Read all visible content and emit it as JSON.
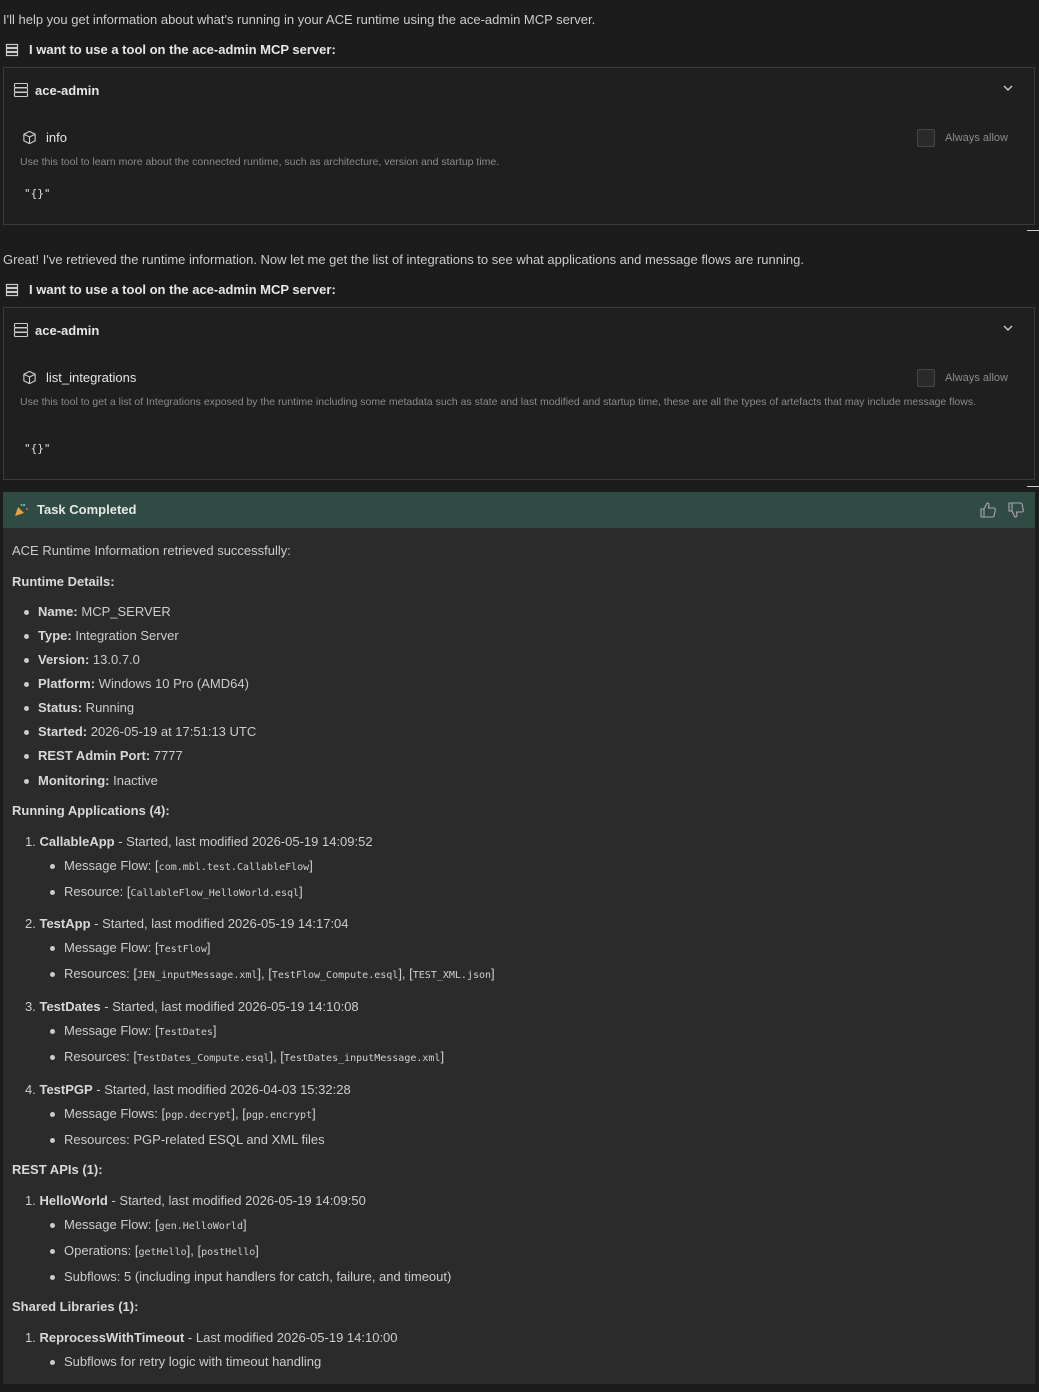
{
  "intro1": "I'll help you get information about what's running in your ACE runtime using the ace-admin MCP server.",
  "tool_request_label": "I want to use a tool on the ace-admin MCP server:",
  "card1": {
    "server": "ace-admin",
    "tool": "info",
    "description": "Use this tool to learn more about the connected runtime, such as architecture, version and startup time.",
    "args": "\"{}\"",
    "always_allow": "Always allow"
  },
  "intro2": "Great! I've retrieved the runtime information. Now let me get the list of integrations to see what applications and message flows are running.",
  "card2": {
    "server": "ace-admin",
    "tool": "list_integrations",
    "description": "Use this tool to get a list of Integrations exposed by the runtime including some metadata such as state and last modified and startup time, these are all the types of artefacts that may include message flows.",
    "args": "\"{}\"",
    "always_allow": "Always allow"
  },
  "task": {
    "title": "Task Completed",
    "summary": "ACE Runtime Information retrieved successfully:",
    "runtime_heading": "Runtime Details:",
    "runtime": [
      {
        "k": "Name:",
        "v": " MCP_SERVER"
      },
      {
        "k": "Type:",
        "v": " Integration Server"
      },
      {
        "k": "Version:",
        "v": " 13.0.7.0"
      },
      {
        "k": "Platform:",
        "v": " Windows 10 Pro (AMD64)"
      },
      {
        "k": "Status:",
        "v": " Running"
      },
      {
        "k": "Started:",
        "v": " 2026-05-19 at 17:51:13 UTC"
      },
      {
        "k": "REST Admin Port:",
        "v": " 7777"
      },
      {
        "k": "Monitoring:",
        "v": " Inactive"
      }
    ],
    "apps_heading": "Running Applications (4):",
    "apps": [
      {
        "num": "1.",
        "name": "CallableApp",
        "meta": " - Started, last modified 2026-05-19 14:09:52",
        "l1": "Message Flow: ",
        "c1": [
          "com.mbl.test.CallableFlow"
        ],
        "l2": "Resource: ",
        "c2": [
          "CallableFlow_HelloWorld.esql"
        ]
      },
      {
        "num": "2.",
        "name": "TestApp",
        "meta": " - Started, last modified 2026-05-19 14:17:04",
        "l1": "Message Flow: ",
        "c1": [
          "TestFlow"
        ],
        "l2": "Resources: ",
        "c2": [
          "JEN_inputMessage.xml",
          "TestFlow_Compute.esql",
          "TEST_XML.json"
        ]
      },
      {
        "num": "3.",
        "name": "TestDates",
        "meta": " - Started, last modified 2026-05-19 14:10:08",
        "l1": "Message Flow: ",
        "c1": [
          "TestDates"
        ],
        "l2": "Resources: ",
        "c2": [
          "TestDates_Compute.esql",
          "TestDates_inputMessage.xml"
        ]
      },
      {
        "num": "4.",
        "name": "TestPGP",
        "meta": " - Started, last modified 2026-04-03 15:32:28",
        "l1": "Message Flows: ",
        "c1": [
          "pgp.decrypt",
          "pgp.encrypt"
        ],
        "l2": "Resources: PGP-related ESQL and XML files",
        "c2": []
      }
    ],
    "rest_heading": "REST APIs (1):",
    "rest": {
      "num": "1.",
      "name": "HelloWorld",
      "meta": " - Started, last modified 2026-05-19 14:09:50",
      "flow_label": "Message Flow: ",
      "flow": "gen.HelloWorld",
      "ops_label": "Operations: ",
      "ops": [
        "getHello",
        "postHello"
      ],
      "subflows": "Subflows: 5 (including input handlers for catch, failure, and timeout)"
    },
    "lib_heading": "Shared Libraries (1):",
    "lib": {
      "num": "1.",
      "name": "ReprocessWithTimeout",
      "meta": " - Last modified 2026-05-19 14:10:00",
      "detail": "Subflows for retry logic with timeout handling"
    }
  }
}
